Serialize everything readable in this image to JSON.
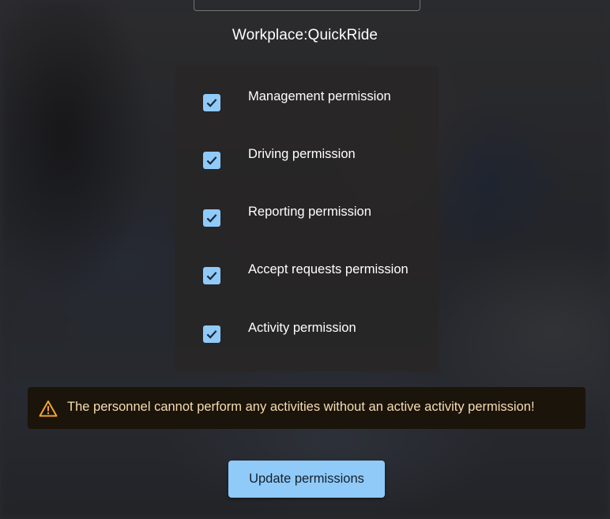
{
  "workplace": {
    "title": "Workplace:QuickRide"
  },
  "permissions": [
    {
      "label": "Management permission",
      "checked": true
    },
    {
      "label": "Driving permission",
      "checked": true
    },
    {
      "label": "Reporting permission",
      "checked": true
    },
    {
      "label": "Accept requests permission",
      "checked": true
    },
    {
      "label": "Activity permission",
      "checked": true
    }
  ],
  "warning": {
    "icon": "warning-triangle-icon",
    "text": "The personnel cannot perform any activities without an active activity permission!"
  },
  "actions": {
    "update_label": "Update permissions"
  },
  "colors": {
    "accent": "#90caf9",
    "warning_icon": "#f2a33a",
    "warning_text": "#f5ddb4",
    "warning_background": "#1b140a",
    "panel_background": "#282626"
  }
}
